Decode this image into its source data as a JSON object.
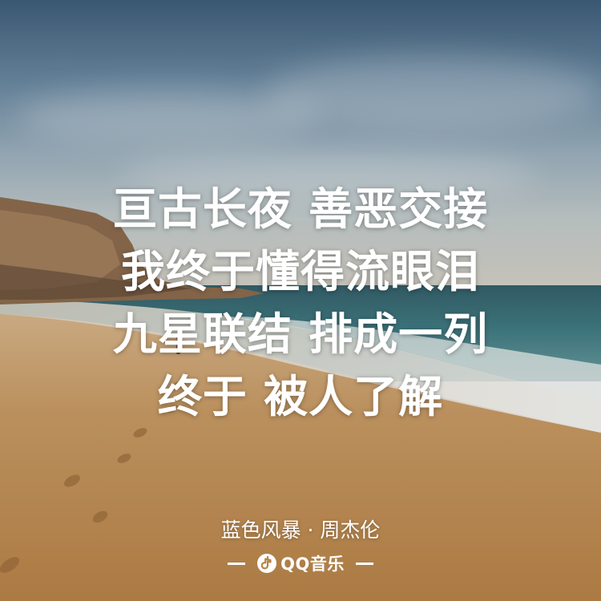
{
  "lyrics": {
    "line1": "亘古长夜 善恶交接",
    "line2": "我终于懂得流眼泪",
    "line3": "九星联结 排成一列",
    "line4": "终于 被人了解"
  },
  "credit": "蓝色风暴 · 周杰伦",
  "brand": {
    "name": "QQ音乐",
    "logo": "qq-music-logo-icon"
  },
  "colors": {
    "text": "#ffffff",
    "sand": "#c2915a",
    "sea": "#3f7a82",
    "sky": "#6b8aa3"
  }
}
